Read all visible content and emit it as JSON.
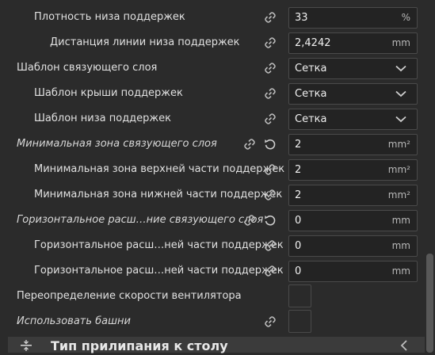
{
  "rows": [
    {
      "label": "Плотность низа поддержек",
      "value": "33",
      "unit": "%"
    },
    {
      "label": "Дистанция линии низа поддержек",
      "value": "2,4242",
      "unit": "mm"
    },
    {
      "label": "Шаблон связующего слоя",
      "value": "Сетка"
    },
    {
      "label": "Шаблон крыши поддержек",
      "value": "Сетка"
    },
    {
      "label": "Шаблон низа поддержек",
      "value": "Сетка"
    },
    {
      "label": "Минимальная зона связующего слоя",
      "value": "2",
      "unit": "mm²"
    },
    {
      "label": "Минимальная зона верхней части поддержек",
      "value": "2",
      "unit": "mm²"
    },
    {
      "label": "Минимальная зона нижней части поддержек",
      "value": "2",
      "unit": "mm²"
    },
    {
      "label": "Горизонтальное расш…ние связующего слоя",
      "value": "0",
      "unit": "mm"
    },
    {
      "label": "Горизонтальное расш…ней части поддержек",
      "value": "0",
      "unit": "mm"
    },
    {
      "label": "Горизонтальное расш…ней части поддержек",
      "value": "0",
      "unit": "mm"
    },
    {
      "label": "Переопределение скорости вентилятора"
    },
    {
      "label": "Использовать башни"
    }
  ],
  "section": {
    "title": "Тип прилипания к столу"
  },
  "icons": {
    "link": "link-icon",
    "reset": "reset-icon",
    "dropdown": "chevron-down-icon",
    "section": "adhesion-icon",
    "collapse": "chevron-left-icon"
  },
  "colors": {
    "background": "#2b2b2b",
    "field_border": "#4a4a4a",
    "text": "#e0e0e0"
  }
}
